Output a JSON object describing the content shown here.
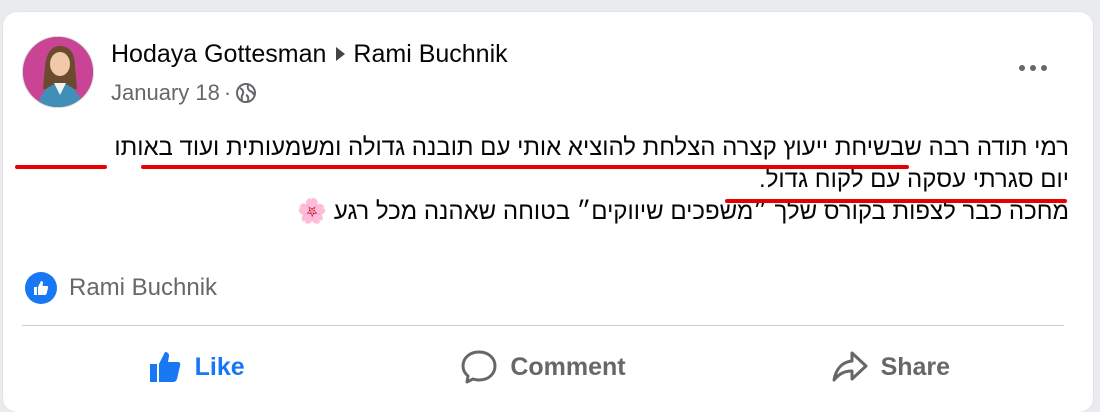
{
  "post": {
    "author": "Hodaya Gottesman",
    "recipient": "Rami Buchnik",
    "date": "January 18",
    "privacy_icon": "globe-icon",
    "more_icon": "more-options-icon",
    "text_lines": [
      "רמי תודה רבה שבשיחת ייעוץ קצרה הצלחת להוציא אותי עם תובנה גדולה ומשמעותית ועוד באותו",
      "יום סגרתי עסקה עם לקוח גדול.",
      "מחכה כבר לצפות בקורס שלך ״משפכים שיווקים״ בטוחה שאהנה מכל רגע"
    ],
    "emoji": "🌸"
  },
  "reactions": {
    "icon": "like-reaction-icon",
    "names": "Rami Buchnik"
  },
  "actions": {
    "like_label": "Like",
    "comment_label": "Comment",
    "share_label": "Share"
  },
  "colors": {
    "accent": "#1877f2",
    "underline": "#e80000",
    "avatar_bg": "#c94495"
  }
}
